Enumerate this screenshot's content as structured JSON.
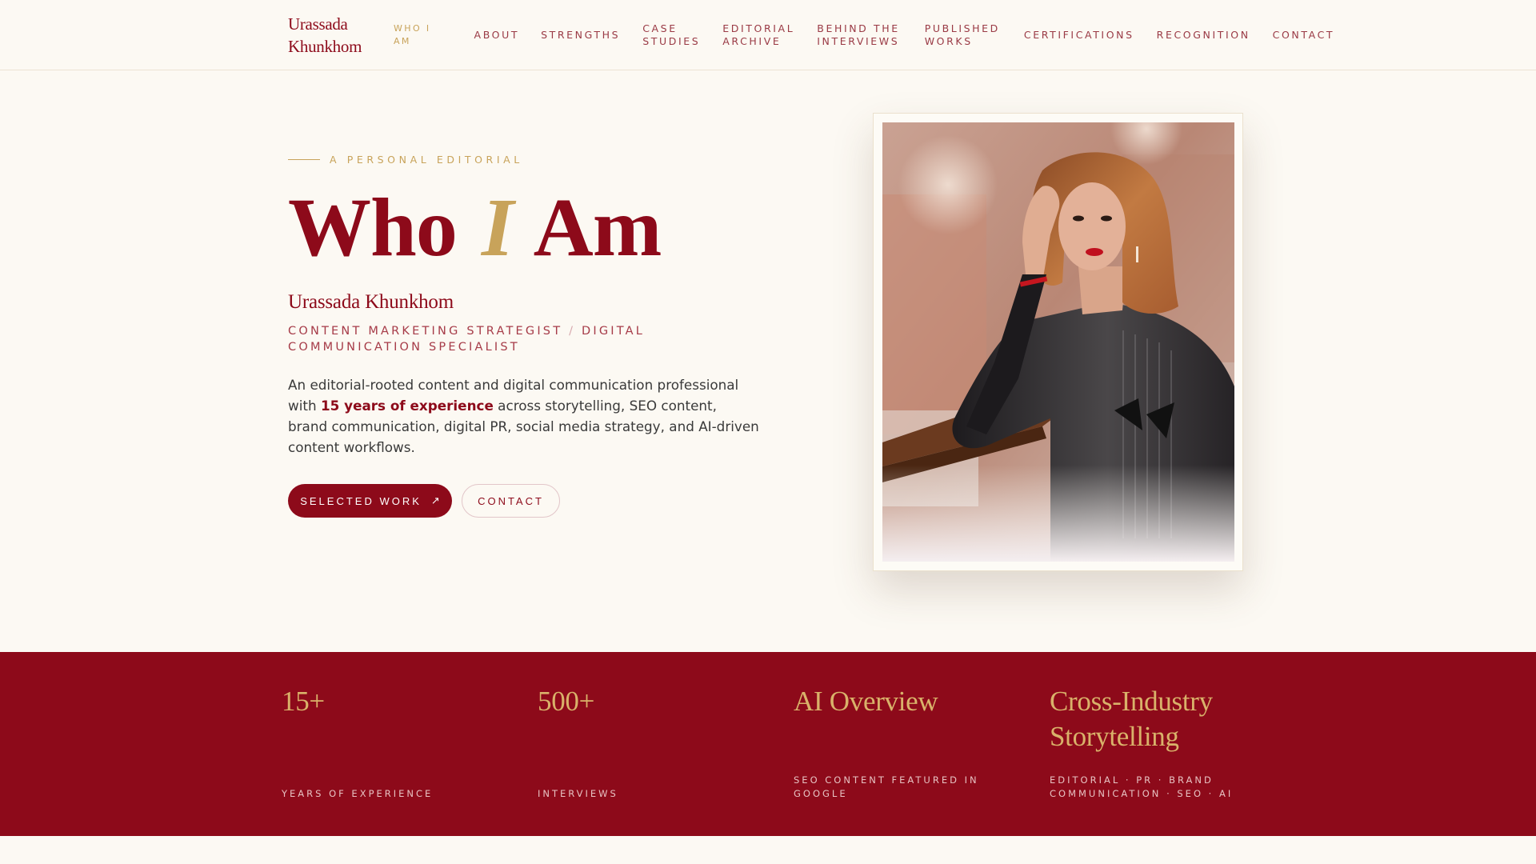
{
  "brand": {
    "line1": "Urassada",
    "line2": "Khunkhom"
  },
  "nav": [
    {
      "line1": "Who I",
      "line2": "Am",
      "active": true
    },
    {
      "line1": "About",
      "line2": ""
    },
    {
      "line1": "Strengths",
      "line2": ""
    },
    {
      "line1": "Case",
      "line2": "Studies"
    },
    {
      "line1": "Editorial",
      "line2": "Archive"
    },
    {
      "line1": "Behind the",
      "line2": "Interviews"
    },
    {
      "line1": "Published",
      "line2": "Works"
    },
    {
      "line1": "Certifications",
      "line2": ""
    },
    {
      "line1": "Recognition",
      "line2": ""
    },
    {
      "line1": "Contact",
      "line2": ""
    }
  ],
  "hero": {
    "eyebrow": "A Personal Editorial",
    "title_part1": "Who",
    "title_accent": "I",
    "title_part2": "Am",
    "name": "Urassada Khunkhom",
    "role_part1": "Content Marketing Strategist",
    "role_separator": "/",
    "role_part2": "Digital Communication Specialist",
    "intro_before": "An editorial-rooted content and digital communication professional with ",
    "intro_highlight": "15 years of experience",
    "intro_after": " across storytelling, SEO content, brand communication, digital PR, social media strategy, and AI-driven content workflows.",
    "primary_button": "Selected Work",
    "primary_button_icon": "↗",
    "secondary_button": "Contact"
  },
  "stats": [
    {
      "value": "15+",
      "label": "Years of Experience"
    },
    {
      "value": "500+",
      "label": "Interviews"
    },
    {
      "value": "AI Overview",
      "label": "SEO Content Featured in Google"
    },
    {
      "value": "Cross-Industry Storytelling",
      "label": "Editorial · PR · Brand Communication · SEO · AI"
    }
  ],
  "colors": {
    "background": "#fcf9f3",
    "primary": "#8d0a1a",
    "gold": "#c8a35a"
  }
}
